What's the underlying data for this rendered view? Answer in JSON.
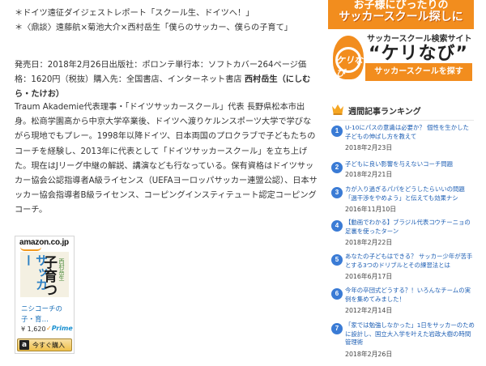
{
  "article": {
    "refs": [
      "＊ドイツ遠征ダイジェストレポート「スクール生、ドイツへ！」",
      "＊〈鼎談〉遠藤航×菊池大介×西村岳生「僕らのサッカー、僕らの子育て」"
    ],
    "meta_text": "発売日：2018年2月26日出版社：ポロンテ単行本：ソフトカバー264ページ価格：1620円（税抜）購入先：全国書店、インターネット書店",
    "author_name": "西村岳生（にしむら・たけお）",
    "bio": "Traum Akademie代表理事・「ドイツサッカースクール」代表 長野県松本市出身。松商学園高から中京大学卒業後、ドイツへ渡りケルンスポーツ大学で学びながら現地でもプレー。1998年以降ドイツ、日本両国のプロクラブで子どもたちのコーチを経験し、2013年に代表として「ドイツサッカースクール」を立ち上げた。現在はJリーグ中継の解説、講演なども行なっている。保有資格はドイツサッカー協会公認指導者A級ライセンス（UEFAヨーロッパサッカー連盟公認）、日本サッカー協会指導者B級ライセンス、コーピングインスティテュート認定コーピングコーチ。"
  },
  "amazon": {
    "logo": "amazon.co.jp",
    "cover_text_1": "サッカー",
    "cover_text_2": "子育つ",
    "cover_text_3": "西村岳生",
    "title": "ニシコーチの子・育…",
    "price": "¥ 1,620",
    "prime": "Prime",
    "button": "今すぐ購入",
    "button_icon": "a"
  },
  "banner": {
    "line1": "お子様にぴったりの",
    "line2": "サッカースクール探しに",
    "site_label": "サッカースクール検索サイト",
    "name": "“ケリなび”",
    "logo_text": "ケリなび",
    "cta": "サッカースクールを探す",
    "colors": {
      "orange": "#f28d1e"
    }
  },
  "ranking": {
    "title": "週間記事ランキング",
    "icon": "crown-icon",
    "number_color": "#3a7bd5",
    "items": [
      {
        "num": "1",
        "title": "U-10にパスの意識は必要か？ 個性を生かした子どもの伸ばし方を教えて",
        "date": "2018年2月23日"
      },
      {
        "num": "2",
        "title": "子どもに良い影響を与えないコーチ問題",
        "date": "2018年2月21日"
      },
      {
        "num": "3",
        "title": "カが入り過ぎるパパをどうしたらいいの問題 「過干渉をやめよう」と伝えても効果ナシ",
        "date": "2016年11月10日"
      },
      {
        "num": "4",
        "title": "【動画でわかる】ブラジル代表コウチーニョの足裏を使ったターン",
        "date": "2018年2月22日"
      },
      {
        "num": "5",
        "title": "あなたの子どもはできる？ サッカー少年が苦手とする3つのドリブルとその練習法とは",
        "date": "2016年6月17日"
      },
      {
        "num": "6",
        "title": "今年の卒団式どうする？！いろんなチームの実例を集めてみました！",
        "date": "2012年2月14日"
      },
      {
        "num": "7",
        "title": "「家では勉強しなかった」1日をサッカーのために設計し、国立大入学を叶えた岩政大樹の時間管理術",
        "date": "2018年2月26日"
      }
    ]
  }
}
